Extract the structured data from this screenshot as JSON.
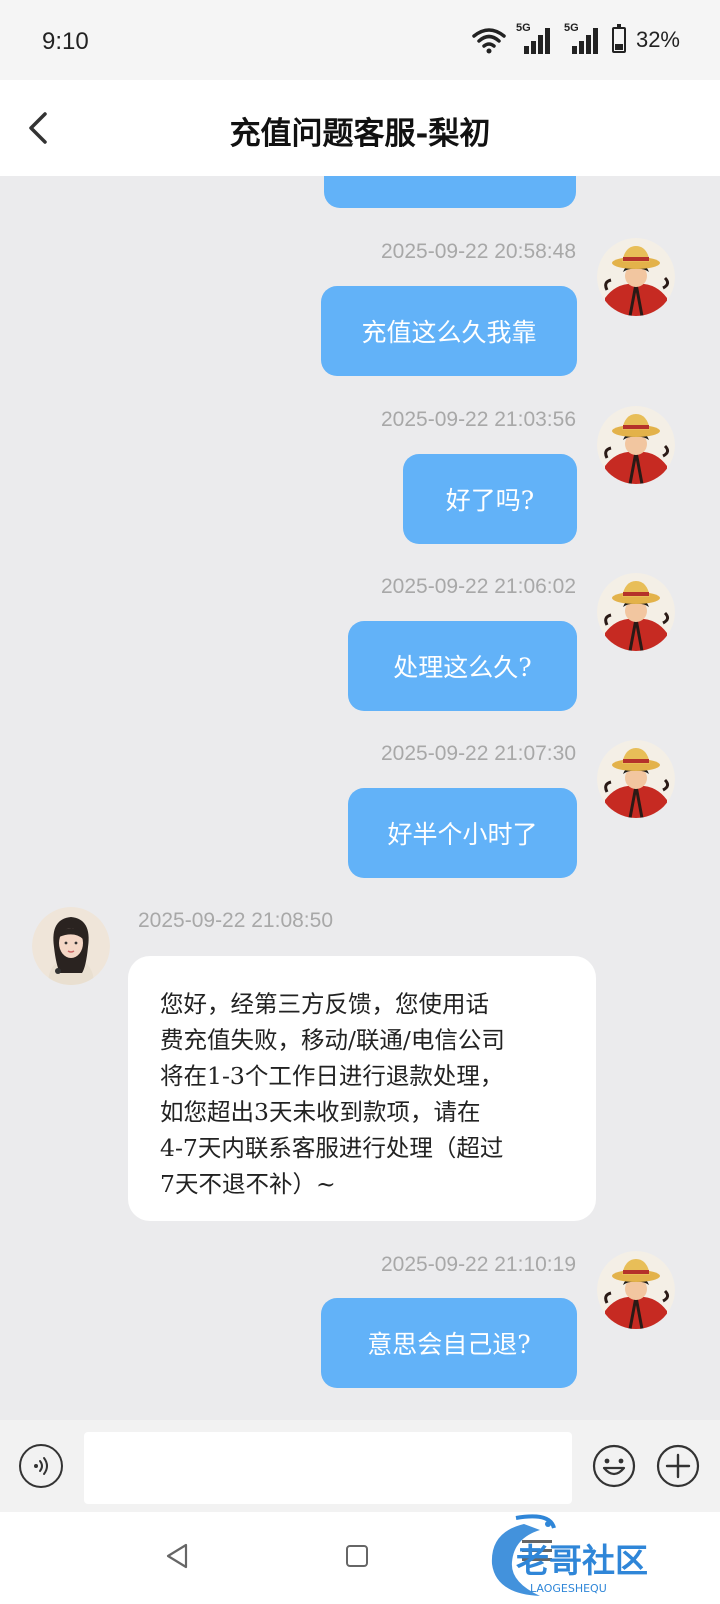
{
  "status_bar": {
    "time": "9:10",
    "network_1": "5G",
    "network_2": "5G",
    "battery": "32%",
    "battery_level": 0.32
  },
  "header": {
    "title": "充值问题客服-梨初"
  },
  "messages": [
    {
      "from": "user",
      "timestamp": "2025-09-22 20:58:48",
      "text": "充值这么久我靠"
    },
    {
      "from": "user",
      "timestamp": "2025-09-22 21:03:56",
      "text": "好了吗?"
    },
    {
      "from": "user",
      "timestamp": "2025-09-22 21:06:02",
      "text": "处理这么久?"
    },
    {
      "from": "user",
      "timestamp": "2025-09-22 21:07:30",
      "text": "好半个小时了"
    },
    {
      "from": "agent",
      "timestamp": "2025-09-22 21:08:50",
      "lines": [
        "您好，经第三方反馈，您使用话",
        "费充值失败，移动/联通/电信公司",
        "将在1-3个工作日进行退款处理，",
        "如您超出3天未收到款项，请在",
        "4-7天内联系客服进行处理（超过",
        "7天不退不补）~"
      ]
    },
    {
      "from": "user",
      "timestamp": "2025-09-22 21:10:19",
      "text": "意思会自己退?"
    }
  ],
  "input": {
    "value": "",
    "placeholder": ""
  },
  "watermark": {
    "main": "老哥社区",
    "sub": "LAOGESHEQU"
  },
  "colors": {
    "outgoing_bubble": "#62b2f8",
    "chat_background": "#ebebed",
    "timestamp": "#a8a8a8"
  },
  "icons": [
    "back-arrow-icon",
    "wifi-icon",
    "signal-icon",
    "battery-icon",
    "voice-icon",
    "emoji-icon",
    "plus-icon",
    "nav-back-icon",
    "nav-home-icon",
    "nav-menu-icon"
  ]
}
